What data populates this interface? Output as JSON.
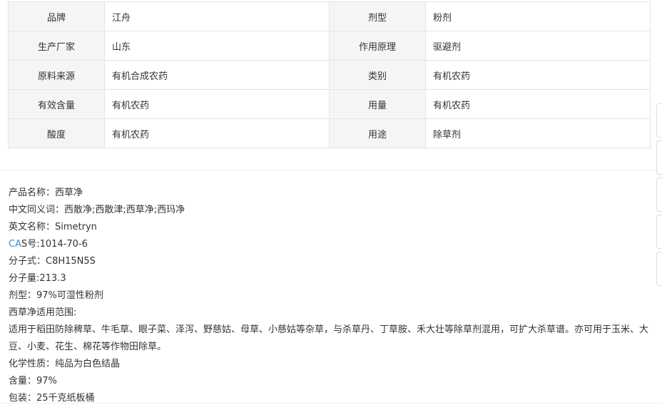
{
  "spec_table": {
    "rows": [
      [
        {
          "label": "品牌",
          "value": "江舟"
        },
        {
          "label": "剂型",
          "value": "粉剂"
        }
      ],
      [
        {
          "label": "生产厂家",
          "value": "山东"
        },
        {
          "label": "作用原理",
          "value": "驱避剂"
        }
      ],
      [
        {
          "label": "原料来源",
          "value": "有机合成农药"
        },
        {
          "label": "类别",
          "value": "有机农药"
        }
      ],
      [
        {
          "label": "有效含量",
          "value": "有机农药"
        },
        {
          "label": "用量",
          "value": "有机农药"
        }
      ],
      [
        {
          "label": "酸度",
          "value": "有机农药"
        },
        {
          "label": "用途",
          "value": "除草剂"
        }
      ]
    ]
  },
  "description": {
    "product_name": "产品名称：西草净",
    "cn_synonyms": "中文同义词：西散净;西散津;西草净;西玛净",
    "en_name": "英文名称：Simetryn",
    "cas_link": "CA",
    "cas_rest": "S号:1014-70-6",
    "formula": "分子式：C8H15N5S",
    "mol_weight": "分子量:213.3",
    "dosage_form": "剂型：97%可湿性粉剂",
    "scope_title": "西草净适用范围:",
    "scope_text": "适用于稻田防除稗草、牛毛草、眼子菜、泽泻、野慈姑、母草、小慈姑等杂草，与杀草丹、丁草胺、禾大壮等除草剂混用，可扩大杀草谱。亦可用于玉米、大豆、小麦、花生、棉花等作物田除草。",
    "chem_props": "化学性质：纯品为白色结晶",
    "content": "含量：97%",
    "packaging": "包装：25千克纸板桶"
  }
}
